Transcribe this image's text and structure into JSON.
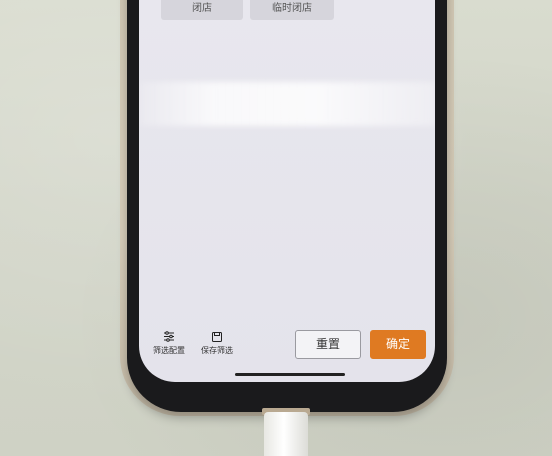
{
  "screen": {
    "chips": {
      "closed_label": "闭店",
      "temp_closed_label": "临时闭店"
    },
    "toolbar": {
      "filter_config_label": "筛选配置",
      "save_filter_label": "保存筛选",
      "reset_label": "重置",
      "confirm_label": "确定"
    },
    "icons": {
      "filter_config": "sliders-icon",
      "save_filter": "save-icon"
    },
    "colors": {
      "confirm_button": "#df7a22",
      "screen_background": "#e6e5ec"
    }
  }
}
